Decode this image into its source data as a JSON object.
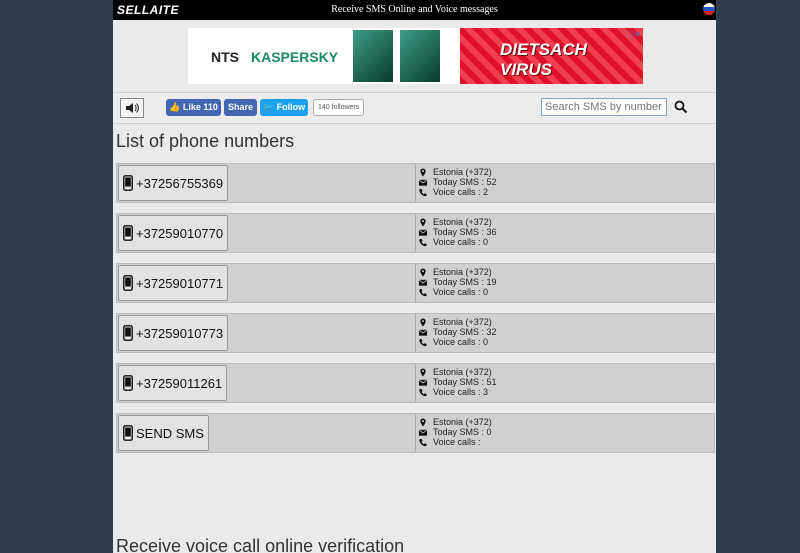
{
  "header": {
    "logo": "SELLAITE",
    "title": "Receive SMS Online and Voice messages"
  },
  "ad": {
    "brand1_a": "NTS",
    "brand2": "KASPERSKY",
    "brand3": "DIETSACH VIRUS"
  },
  "social": {
    "like_label": "Like 110",
    "share_label": "Share",
    "follow_label": "Follow",
    "followers": "140 followers"
  },
  "search": {
    "placeholder": "Search SMS by number",
    "value": ""
  },
  "list": {
    "heading": "List of phone numbers",
    "items": [
      {
        "number": "+37256755369",
        "country": "Estonia (+372)",
        "sms": "Today SMS : 52",
        "calls": "Voice calls : 2"
      },
      {
        "number": "+37259010770",
        "country": "Estonia (+372)",
        "sms": "Today SMS : 36",
        "calls": "Voice calls : 0"
      },
      {
        "number": "+37259010771",
        "country": "Estonia (+372)",
        "sms": "Today SMS : 19",
        "calls": "Voice calls : 0"
      },
      {
        "number": "+37259010773",
        "country": "Estonia (+372)",
        "sms": "Today SMS : 32",
        "calls": "Voice calls : 0"
      },
      {
        "number": "+37259011261",
        "country": "Estonia (+372)",
        "sms": "Today SMS : 51",
        "calls": "Voice calls : 3"
      },
      {
        "number": "SEND SMS",
        "country": "Estonia (+372)",
        "sms": "Today SMS : 0",
        "calls": "Voice calls :"
      }
    ]
  },
  "voice": {
    "heading": "Receive voice call online verification"
  },
  "colors": {
    "background": "#2f3e4f",
    "facebook": "#4267b2",
    "twitter": "#1da1f2"
  }
}
